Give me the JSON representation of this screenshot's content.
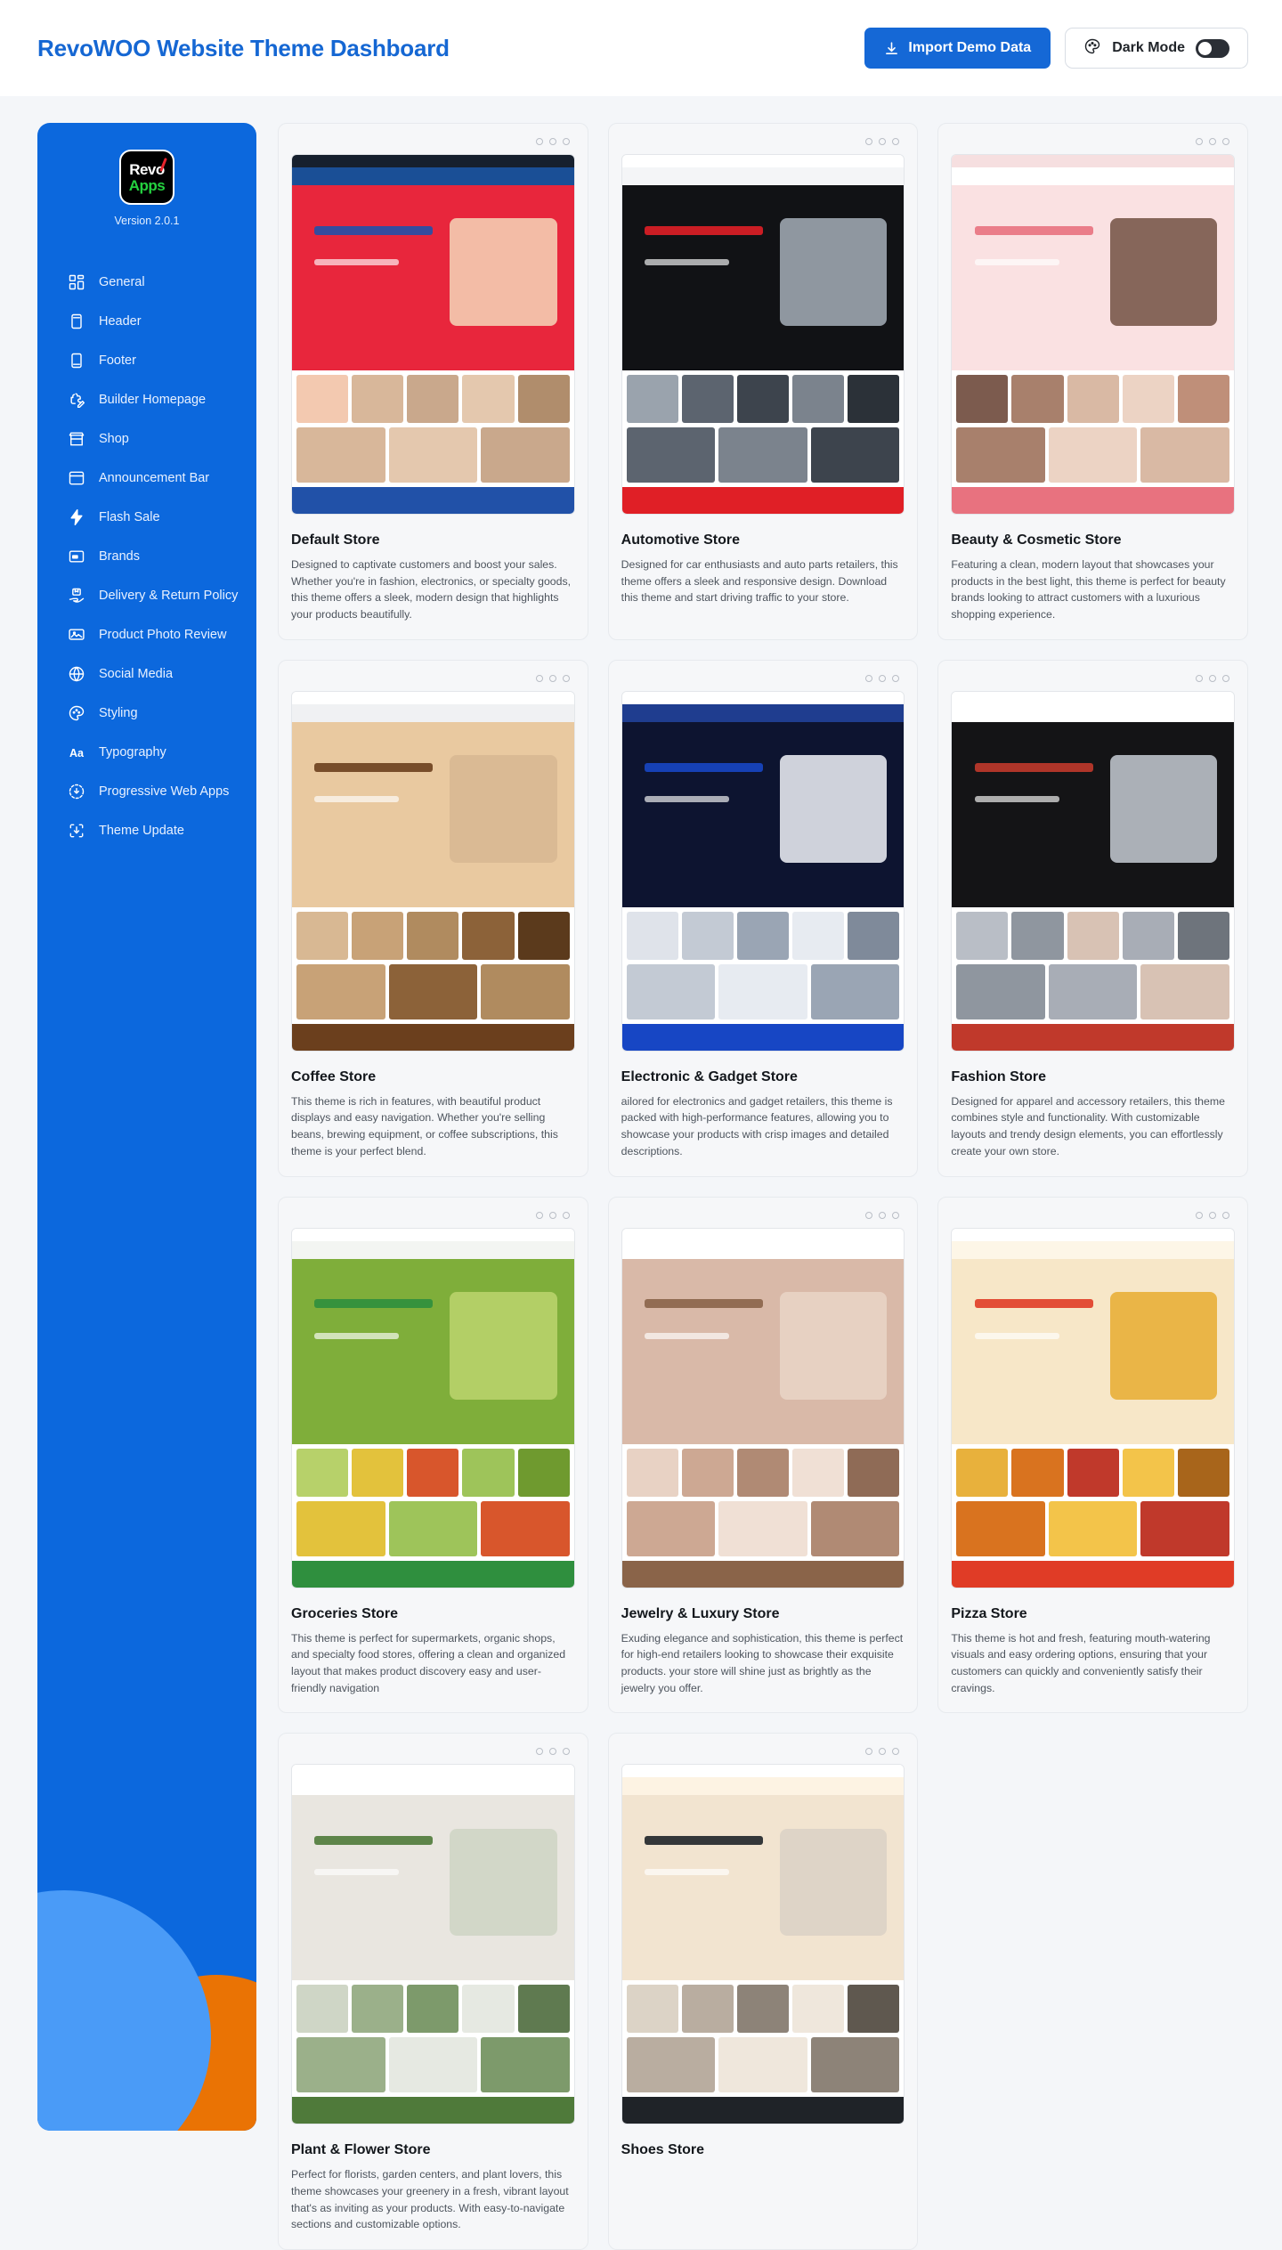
{
  "header": {
    "title": "RevoWOO Website Theme Dashboard",
    "import_button": "Import Demo Data",
    "import_icon": "download-icon",
    "dark_mode_label": "Dark Mode",
    "dark_mode_icon": "palette-icon",
    "dark_mode_on": false,
    "accent_color": "#1567d3"
  },
  "sidebar": {
    "logo_top": "Revo",
    "logo_bottom": "Apps",
    "version": "Version 2.0.1",
    "background_color": "#0c68dd",
    "items": [
      {
        "label": "General",
        "icon": "grid-icon"
      },
      {
        "label": "Header",
        "icon": "header-panel-icon"
      },
      {
        "label": "Footer",
        "icon": "footer-panel-icon"
      },
      {
        "label": "Builder Homepage",
        "icon": "puzzle-pencil-icon"
      },
      {
        "label": "Shop",
        "icon": "store-icon"
      },
      {
        "label": "Announcement Bar",
        "icon": "window-icon"
      },
      {
        "label": "Flash Sale",
        "icon": "lightning-icon"
      },
      {
        "label": "Brands",
        "icon": "brand-card-icon"
      },
      {
        "label": "Delivery & Return Policy",
        "icon": "delivery-hand-icon"
      },
      {
        "label": "Product Photo Review",
        "icon": "photo-icon"
      },
      {
        "label": "Social Media",
        "icon": "globe-icon"
      },
      {
        "label": "Styling",
        "icon": "palette-icon"
      },
      {
        "label": "Typography",
        "icon": "typography-aa-icon"
      },
      {
        "label": "Progressive Web Apps",
        "icon": "pwa-download-icon"
      },
      {
        "label": "Theme Update",
        "icon": "theme-update-icon"
      }
    ]
  },
  "themes": [
    {
      "title": "Default Store",
      "description": "Designed to captivate customers and boost your sales. Whether you're in fashion, electronics, or specialty goods, this theme offers a sleek, modern design that highlights your products beautifully.",
      "palette": {
        "top": "#16202e",
        "nav": "#1a4f96",
        "hero": "#e8263c",
        "a": "#f3c9b0",
        "b": "#d8b79a",
        "c": "#c9a88c",
        "d": "#e4c8ae",
        "e": "#b08d6c",
        "accent": "#2151a8"
      }
    },
    {
      "title": "Automotive Store",
      "description": "Designed for car enthusiasts and auto parts retailers, this theme offers a sleek and responsive design. Download this theme and start driving traffic to your store.",
      "palette": {
        "top": "#ffffff",
        "nav": "#f4f5f7",
        "hero": "#111215",
        "a": "#9aa3ad",
        "b": "#5c646f",
        "c": "#3d444d",
        "d": "#7b838d",
        "e": "#2b3138",
        "accent": "#e01f26"
      }
    },
    {
      "title": "Beauty & Cosmetic Store",
      "description": "Featuring a clean, modern layout that showcases your products in the best light, this theme is perfect for beauty brands looking to attract customers with a luxurious shopping experience.",
      "palette": {
        "top": "#f6dfe0",
        "nav": "#ffffff",
        "hero": "#fae1e2",
        "a": "#7c5b4e",
        "b": "#a8806c",
        "c": "#d9b9a4",
        "d": "#ecd3c4",
        "e": "#bf8f79",
        "accent": "#e8727f"
      }
    },
    {
      "title": "Coffee Store",
      "description": "This theme is rich in features, with beautiful product displays and easy navigation. Whether you're selling beans, brewing equipment, or coffee subscriptions, this theme is your perfect blend.",
      "palette": {
        "top": "#ffffff",
        "nav": "#f0f1f3",
        "hero": "#e9c9a0",
        "a": "#d8b893",
        "b": "#c8a277",
        "c": "#b08b5f",
        "d": "#8c6239",
        "e": "#5b3a1c",
        "accent": "#6b3f1d"
      }
    },
    {
      "title": "Electronic & Gadget Store",
      "description": "ailored for electronics and gadget retailers, this theme is packed with high-performance features, allowing you to showcase your products with crisp images and detailed descriptions.",
      "palette": {
        "top": "#ffffff",
        "nav": "#1f3d8f",
        "hero": "#0d1430",
        "a": "#dfe3ea",
        "b": "#c3cad4",
        "c": "#9aa5b4",
        "d": "#e7ebf1",
        "e": "#7f8a9a",
        "accent": "#1746c4"
      }
    },
    {
      "title": "Fashion Store",
      "description": "Designed for apparel and accessory retailers, this theme combines style and functionality. With customizable layouts and trendy design elements, you can effortlessly create your own store.",
      "palette": {
        "top": "#ffffff",
        "nav": "#ffffff",
        "hero": "#141416",
        "a": "#b9bec6",
        "b": "#8f969f",
        "c": "#d8c2b4",
        "d": "#a8adb6",
        "e": "#6e747c",
        "accent": "#c0392b"
      }
    },
    {
      "title": "Groceries Store",
      "description": "This theme is perfect for supermarkets, organic shops, and specialty food stores, offering a clean and organized layout that makes product discovery easy and user-friendly navigation",
      "palette": {
        "top": "#ffffff",
        "nav": "#f3f5f2",
        "hero": "#7fae3a",
        "a": "#b7d16a",
        "b": "#e3c23c",
        "c": "#d8562c",
        "d": "#9ec45a",
        "e": "#6f9a2f",
        "accent": "#2f8f3e"
      }
    },
    {
      "title": "Jewelry & Luxury Store",
      "description": "Exuding elegance and sophistication, this theme is perfect for high-end retailers looking to showcase their exquisite products.  your store will shine just as brightly as the jewelry you offer.",
      "palette": {
        "top": "#ffffff",
        "nav": "#ffffff",
        "hero": "#d9b9a8",
        "a": "#e8d2c4",
        "b": "#cda893",
        "c": "#b08a74",
        "d": "#f0e0d5",
        "e": "#8f6b56",
        "accent": "#8a6449"
      }
    },
    {
      "title": "Pizza Store",
      "description": "This theme is hot and fresh, featuring mouth-watering visuals and easy ordering options, ensuring that your customers can quickly and conveniently satisfy their cravings.",
      "palette": {
        "top": "#ffffff",
        "nav": "#fdf6e7",
        "hero": "#f7e7c8",
        "a": "#e8b13c",
        "b": "#d9731f",
        "c": "#c0392b",
        "d": "#f3c44a",
        "e": "#a8651b",
        "accent": "#e03c26"
      }
    },
    {
      "title": "Plant & Flower Store",
      "description": "Perfect for florists, garden centers, and plant lovers, this theme showcases your greenery in a fresh, vibrant layout that's as inviting as your products. With easy-to-navigate sections and customizable options.",
      "palette": {
        "top": "#ffffff",
        "nav": "#ffffff",
        "hero": "#e9e6e0",
        "a": "#cfd6c6",
        "b": "#9bb08a",
        "c": "#7d9a6b",
        "d": "#e6e9e2",
        "e": "#5f7a50",
        "accent": "#4f7a3a"
      }
    },
    {
      "title": "Shoes Store",
      "description": "",
      "palette": {
        "top": "#ffffff",
        "nav": "#fdf3e3",
        "hero": "#f2e4d0",
        "a": "#dcd3c6",
        "b": "#b9ada0",
        "c": "#8d8378",
        "d": "#efe7dc",
        "e": "#5f584f",
        "accent": "#1f2328"
      }
    }
  ]
}
